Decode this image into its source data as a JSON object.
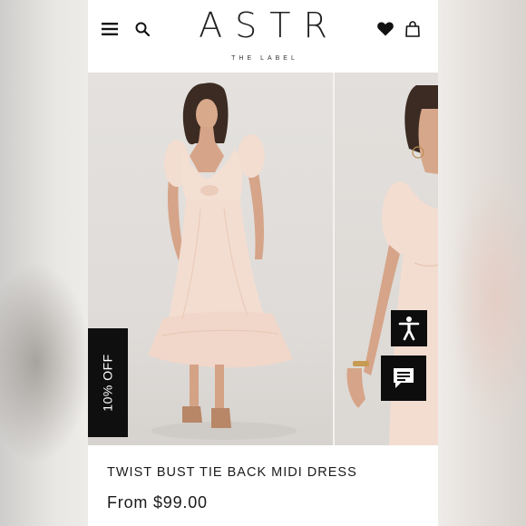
{
  "header": {
    "brand_name": "ASTR",
    "brand_tagline": "THE LABEL",
    "icons": [
      "menu-icon",
      "search-icon",
      "heart-icon",
      "bag-icon"
    ]
  },
  "gallery": {
    "promo_badge": "10% OFF",
    "accent_color": "#0f0f0f"
  },
  "product": {
    "title": "TWIST BUST TIE BACK MIDI DRESS",
    "price": "From $99.00"
  },
  "colors": {
    "dress": "#f3ddd1",
    "background": "#ffffff",
    "text": "#1a1a1a"
  }
}
